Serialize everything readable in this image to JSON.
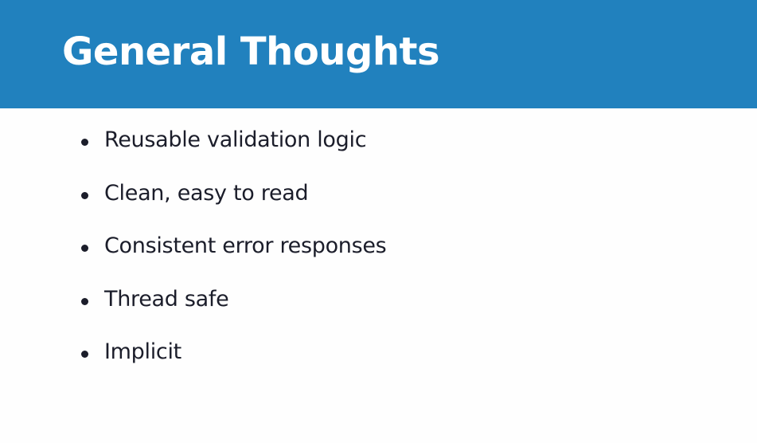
{
  "slide": {
    "title": "General Thoughts",
    "bullets": [
      "Reusable validation logic",
      "Clean, easy to read",
      "Consistent error responses",
      "Thread safe",
      "Implicit"
    ]
  },
  "colors": {
    "title_bar": "#2181be",
    "title_text": "#ffffff",
    "body_text": "#1b1d2a",
    "background": "#fefefe"
  }
}
